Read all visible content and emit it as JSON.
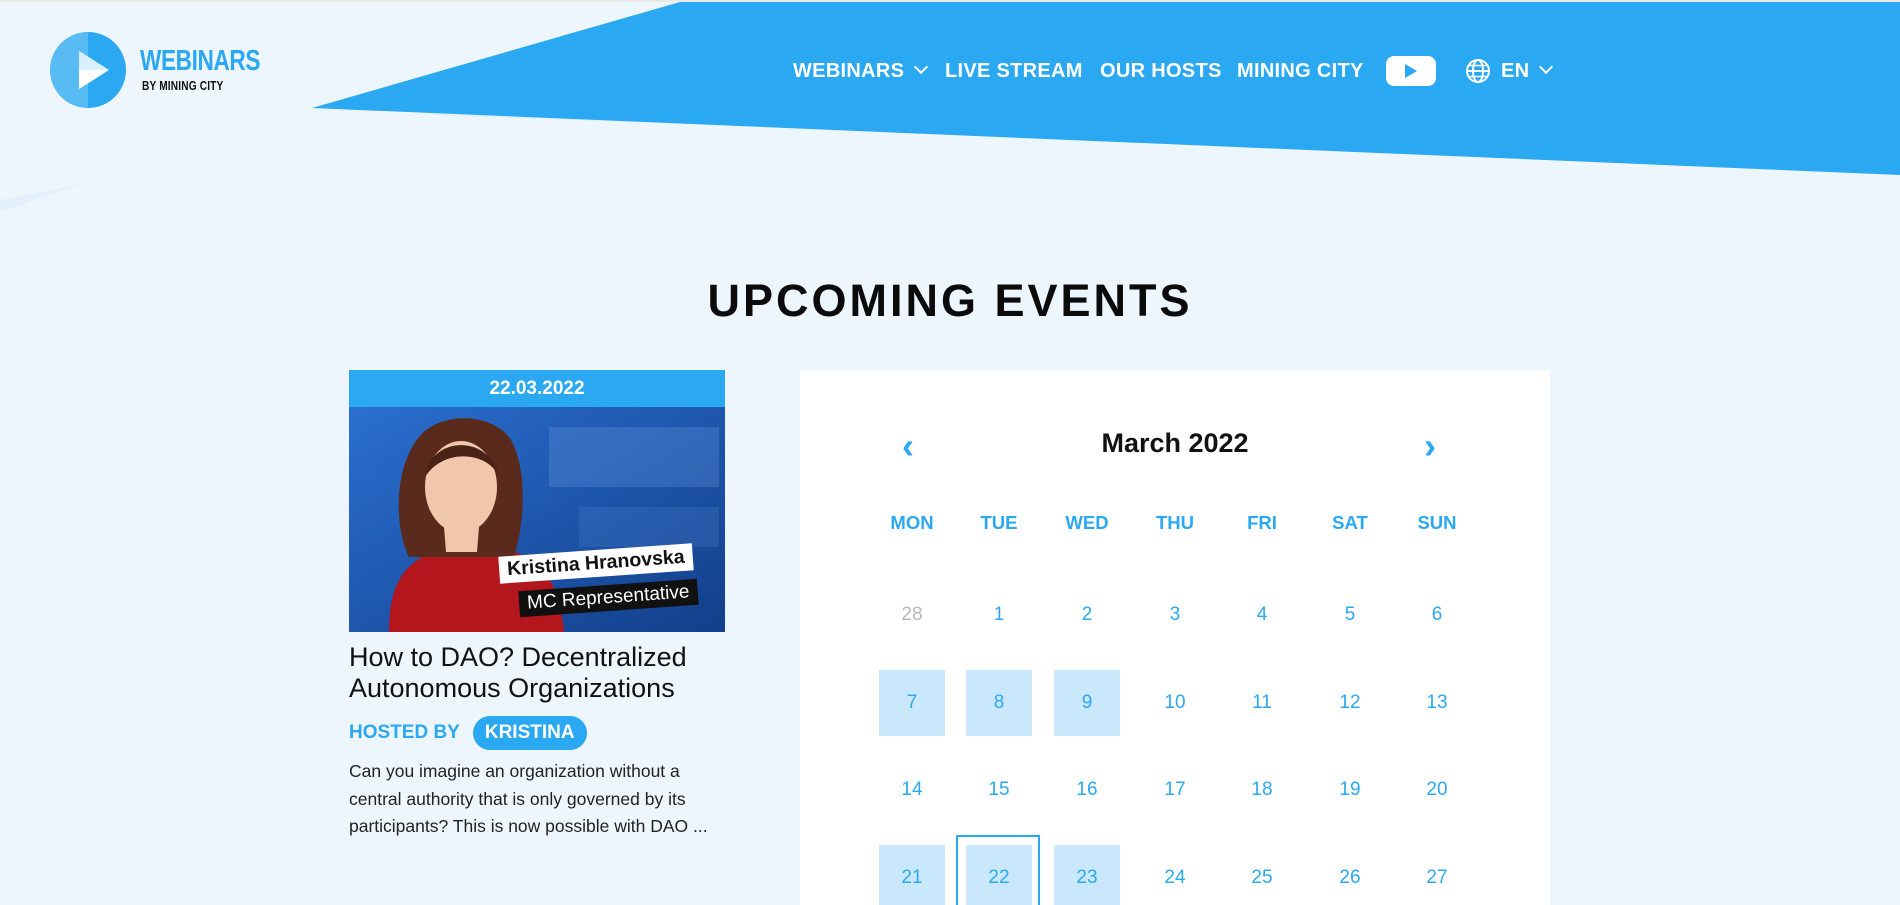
{
  "brand": {
    "title": "WEBINARS",
    "subtitle": "BY MINING CITY"
  },
  "nav": {
    "webinars_label": "WEBINARS",
    "live_stream_label": "LIVE STREAM",
    "our_hosts_label": "OUR HOSTS",
    "mining_city_label": "MINING CITY",
    "language_label": "EN"
  },
  "colors": {
    "accent": "#2aa8f2",
    "header_bg": "#2aa8f2",
    "page_bg": "#eef6fd",
    "event_day_bg": "#c9e8fb"
  },
  "section": {
    "title": "UPCOMING EVENTS"
  },
  "event": {
    "date": "22.03.2022",
    "image_name_tag": "Kristina Hranovska",
    "image_role_tag": "MC Representative",
    "title": "How to DAO? Decentralized Autonomous Organizations",
    "hosted_by_label": "HOSTED BY",
    "host_name": "KRISTINA",
    "description": "Can you imagine an organization without a central authority that is only governed by its participants? This is now possible with DAO ..."
  },
  "calendar": {
    "month_label": "March 2022",
    "prev_icon": "chevron-left-icon",
    "next_icon": "chevron-right-icon",
    "weekdays": [
      "MON",
      "TUE",
      "WED",
      "THU",
      "FRI",
      "SAT",
      "SUN"
    ],
    "weeks": [
      [
        {
          "d": "28",
          "muted": true
        },
        {
          "d": "1"
        },
        {
          "d": "2"
        },
        {
          "d": "3"
        },
        {
          "d": "4"
        },
        {
          "d": "5"
        },
        {
          "d": "6"
        }
      ],
      [
        {
          "d": "7",
          "event": true
        },
        {
          "d": "8",
          "event": true
        },
        {
          "d": "9",
          "event": true
        },
        {
          "d": "10"
        },
        {
          "d": "11"
        },
        {
          "d": "12"
        },
        {
          "d": "13"
        }
      ],
      [
        {
          "d": "14"
        },
        {
          "d": "15"
        },
        {
          "d": "16"
        },
        {
          "d": "17"
        },
        {
          "d": "18"
        },
        {
          "d": "19"
        },
        {
          "d": "20"
        }
      ],
      [
        {
          "d": "21",
          "event": true
        },
        {
          "d": "22",
          "event": true,
          "selected": true
        },
        {
          "d": "23",
          "event": true
        },
        {
          "d": "24"
        },
        {
          "d": "25"
        },
        {
          "d": "26"
        },
        {
          "d": "27"
        }
      ]
    ]
  }
}
